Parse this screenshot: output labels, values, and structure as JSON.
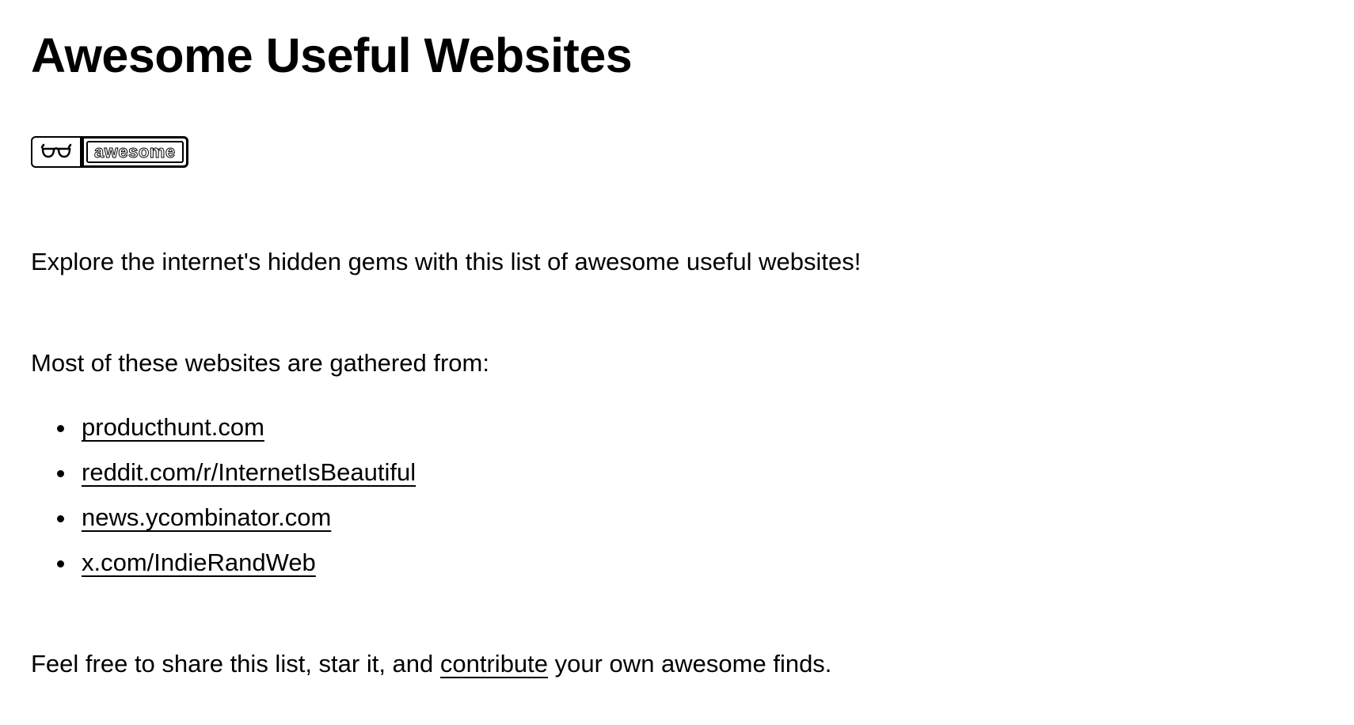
{
  "header": {
    "title": "Awesome Useful Websites"
  },
  "badge": {
    "icon": "sunglasses-icon",
    "label": "awesome"
  },
  "content": {
    "intro": "Explore the internet's hidden gems with this list of awesome useful websites!",
    "gathered_from": "Most of these websites are gathered from:",
    "sources": [
      {
        "label": "producthunt.com"
      },
      {
        "label": "reddit.com/r/InternetIsBeautiful"
      },
      {
        "label": "news.ycombinator.com"
      },
      {
        "label": "x.com/IndieRandWeb"
      }
    ],
    "outro_before": "Feel free to share this list, star it, and ",
    "outro_link": "contribute",
    "outro_after": " your own awesome finds."
  }
}
